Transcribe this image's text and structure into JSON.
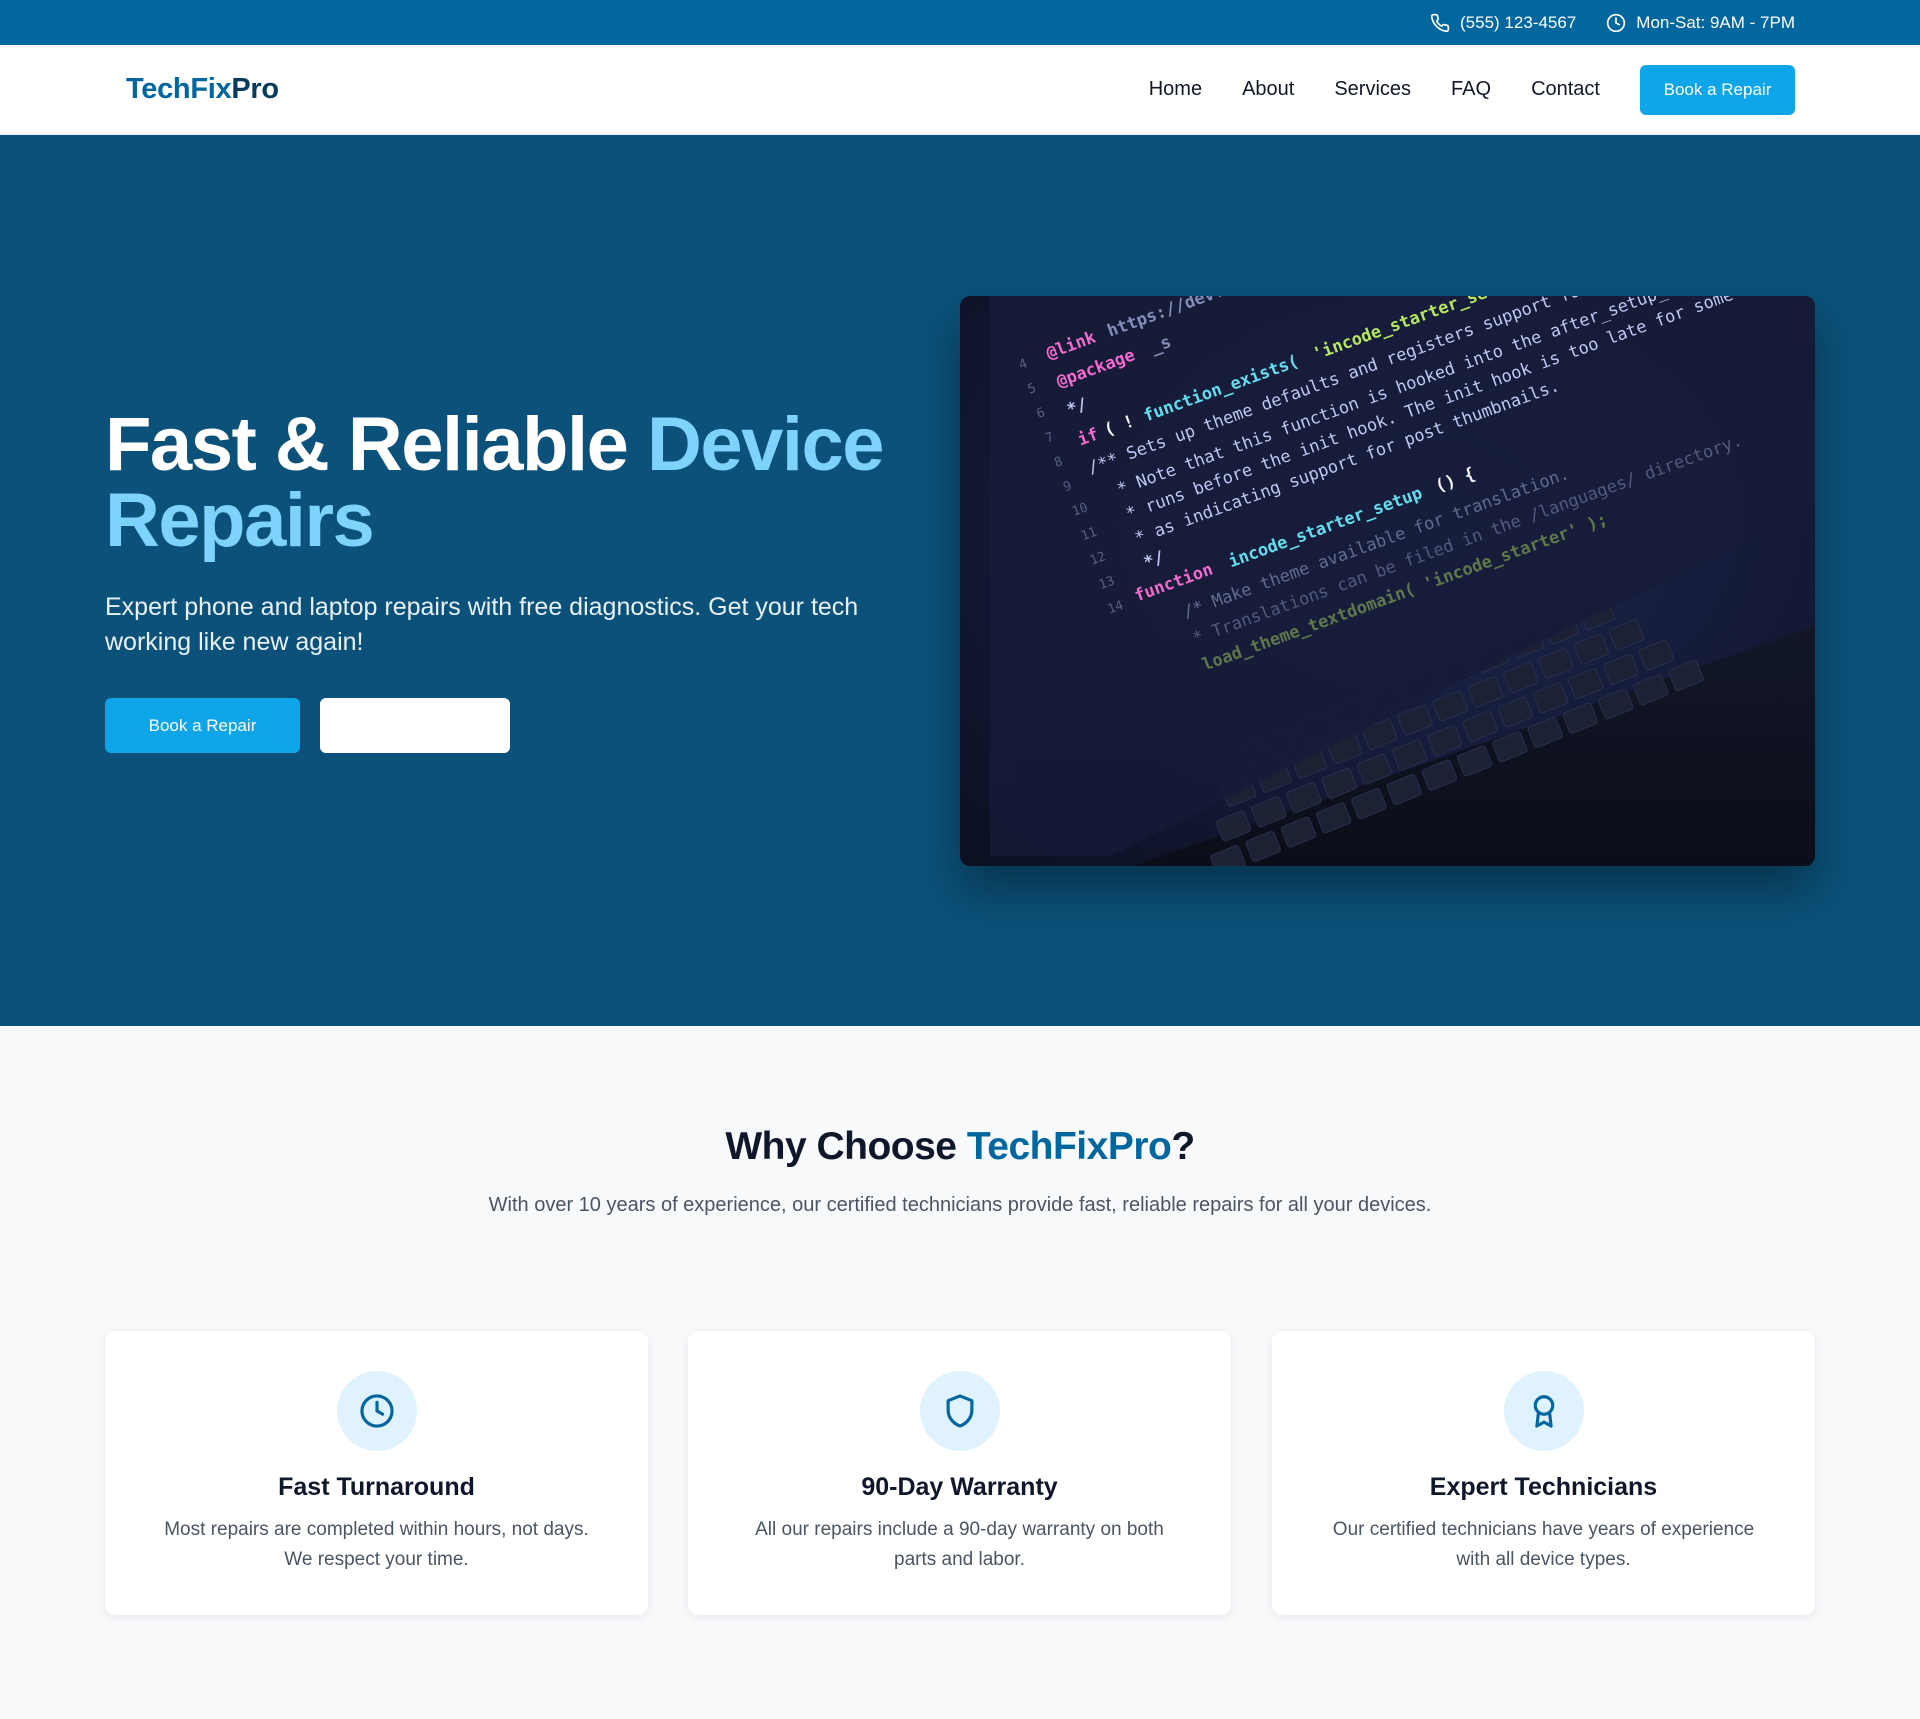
{
  "topbar": {
    "phone": "(555) 123-4567",
    "hours": "Mon-Sat: 9AM - 7PM",
    "phone_icon": "phone-icon",
    "hours_icon": "clock-icon"
  },
  "nav": {
    "logo_part1": "TechFix",
    "logo_part2": "Pro",
    "links": [
      "Home",
      "About",
      "Services",
      "FAQ",
      "Contact"
    ],
    "cta": "Book a Repair"
  },
  "hero": {
    "title_main": "Fast & Reliable ",
    "title_accent": "Device Repairs",
    "subtitle": "Expert phone and laptop repairs with free diagnostics. Get your tech working like new again!",
    "primary_button": "Book a Repair",
    "secondary_button": "",
    "image": "laptop-code-photo"
  },
  "why": {
    "title_prefix": "Why Choose ",
    "title_brand": "TechFixPro",
    "title_suffix": "?",
    "subtitle": "With over 10 years of experience, our certified technicians provide fast, reliable repairs for all your devices.",
    "cards": [
      {
        "icon": "clock-icon",
        "title": "Fast Turnaround",
        "text": "Most repairs are completed within hours, not days. We respect your time."
      },
      {
        "icon": "shield-icon",
        "title": "90-Day Warranty",
        "text": "All our repairs include a 90-day warranty on both parts and labor."
      },
      {
        "icon": "award-icon",
        "title": "Expert Technicians",
        "text": "Our certified technicians have years of experience with all device types."
      }
    ]
  },
  "colors": {
    "topbar": "#02669f",
    "hero_bg": "#0b5179",
    "accent": "#0ea5e9",
    "accent_light": "#7dd3fc",
    "brand": "#02669f"
  }
}
